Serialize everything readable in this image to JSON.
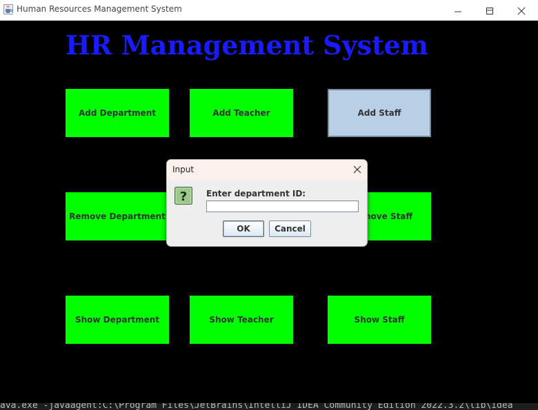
{
  "window": {
    "title": "Human Resources Management System",
    "icon": "java-cup-icon"
  },
  "heading": "HR Management System",
  "buttons": {
    "add_department": "Add Department",
    "add_teacher": "Add Teacher",
    "add_staff": "Add Staff",
    "remove_department": "Remove Department",
    "remove_staff": "nove Staff",
    "show_department": "Show Department",
    "show_teacher": "Show Teacher",
    "show_staff": "Show Staff"
  },
  "dialog": {
    "title": "Input",
    "icon": "question-icon",
    "prompt": "Enter department ID:",
    "input_value": "",
    "ok_label": "OK",
    "cancel_label": "Cancel"
  },
  "console_text": "ava.exe  -javaagent:C:\\Program Files\\JetBrains\\IntelliJ IDEA Community Edition 2022.3.2\\lib\\idea",
  "colors": {
    "button_green": "#00ff00",
    "heading_blue": "#1a1aff",
    "selected_button": "#b8cfe5",
    "background": "#000000"
  }
}
